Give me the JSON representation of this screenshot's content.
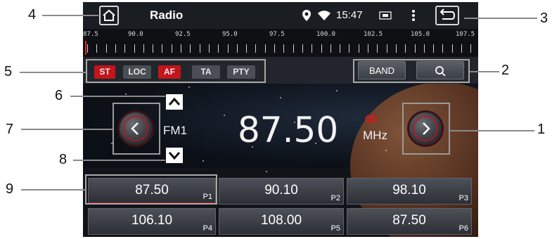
{
  "header": {
    "title": "Radio",
    "time": "15:47"
  },
  "ruler": {
    "labels": [
      "87.5",
      "90.0",
      "92.5",
      "95.0",
      "97.5",
      "100.0",
      "102.5",
      "105.0",
      "107.5"
    ]
  },
  "toolbar": {
    "chips": [
      {
        "label": "ST",
        "active": true
      },
      {
        "label": "LOC",
        "active": false
      },
      {
        "label": "AF",
        "active": true
      },
      {
        "label": "TA",
        "active": false
      },
      {
        "label": "PTY",
        "active": false
      }
    ],
    "band_label": "BAND"
  },
  "tuner": {
    "band": "FM1",
    "frequency": "87.50",
    "unit": "MHz"
  },
  "presets": [
    {
      "freq": "87.50",
      "tag": "P1",
      "active": true
    },
    {
      "freq": "90.10",
      "tag": "P2",
      "active": false
    },
    {
      "freq": "98.10",
      "tag": "P3",
      "active": false
    },
    {
      "freq": "106.10",
      "tag": "P4",
      "active": false
    },
    {
      "freq": "108.00",
      "tag": "P5",
      "active": false
    },
    {
      "freq": "87.50",
      "tag": "P6",
      "active": false
    }
  ],
  "callouts": [
    "1",
    "2",
    "3",
    "4",
    "5",
    "6",
    "7",
    "8",
    "9"
  ],
  "colors": {
    "accent": "#c3151b",
    "background": "#101318"
  },
  "icons": [
    "home-icon",
    "location-pin-icon",
    "wifi-icon",
    "screen-icon",
    "more-vertical-icon",
    "back-icon",
    "search-icon",
    "chevron-up-icon",
    "chevron-down-icon",
    "chevron-left-icon",
    "chevron-right-icon",
    "stereo-icon"
  ]
}
